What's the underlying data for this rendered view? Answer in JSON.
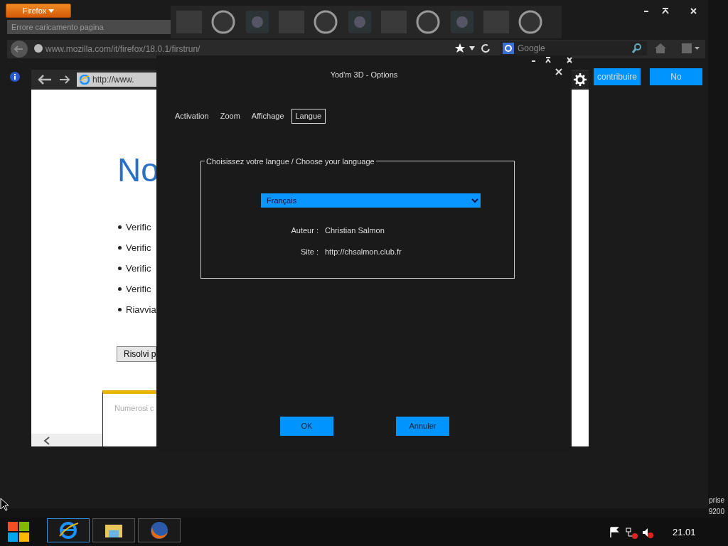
{
  "firefox": {
    "menu_button": "Firefox",
    "tab": {
      "title": "Errore caricamento pagina"
    },
    "url": "www.mozilla.com/it/firefox/18.0.1/firstrun/",
    "search": {
      "placeholder": "Google"
    }
  },
  "notification": {
    "buttons": [
      {
        "label": "contribuire"
      },
      {
        "label": "No"
      }
    ]
  },
  "ie_window": {
    "address": "http://www.",
    "heading": "No",
    "bullets": [
      "Verific",
      "Verific",
      "Verific",
      "Verific",
      "Riavvia"
    ],
    "button": "Risolvi p",
    "tip_box": "Numerosi c"
  },
  "dialog": {
    "title": "Yod'm 3D - Options",
    "tabs": [
      {
        "label": "Activation",
        "selected": false
      },
      {
        "label": "Zoom",
        "selected": false
      },
      {
        "label": "Affichage",
        "selected": false
      },
      {
        "label": "Langue",
        "selected": true
      }
    ],
    "group_title": "Choisissez votre langue / Choose your language",
    "language": "Français",
    "fields": [
      {
        "label": "Auteur :",
        "value": "Christian Salmon"
      },
      {
        "label": "Site :",
        "value": "http://chsalmon.club.fr"
      }
    ],
    "buttons": [
      "OK",
      "Annuler"
    ]
  },
  "desktop": {
    "corner_text": [
      "prise",
      "9200"
    ]
  },
  "taskbar": {
    "apps": [
      {
        "kind": "ie",
        "selected": true
      },
      {
        "kind": "explorer",
        "selected": false
      },
      {
        "kind": "firefox",
        "selected": false
      }
    ],
    "clock": "21.01"
  }
}
